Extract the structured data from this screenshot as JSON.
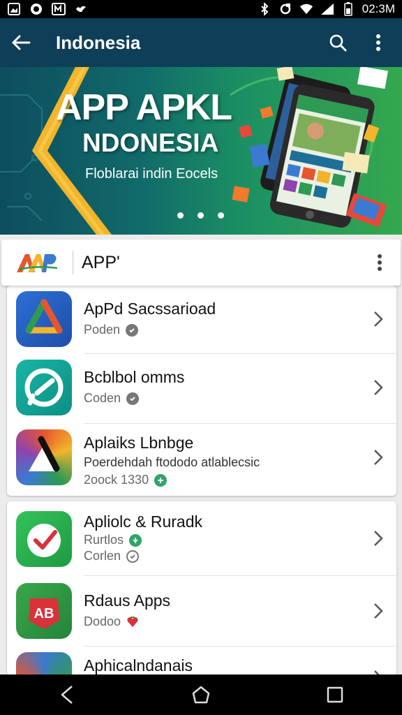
{
  "status_bar": {
    "time": "02:3M",
    "left_icons": [
      "gallery-icon",
      "record-icon",
      "m-app-icon",
      "bird-icon"
    ],
    "right_icons": [
      "bluetooth-icon",
      "sync-icon",
      "wifi-icon",
      "signal-icon",
      "battery-icon"
    ]
  },
  "app_bar": {
    "title": "Indonesia",
    "back_icon": "arrow-left-icon",
    "search_icon": "search-icon",
    "menu_icon": "more-vert-icon"
  },
  "banner": {
    "title": "APP APKL",
    "subtitle": "NDONESIA",
    "tagline": "Floblarai indin Eocels",
    "dots": 3
  },
  "section": {
    "title": "APP'",
    "logo_text": "AP",
    "menu_icon": "more-vert-icon"
  },
  "apps_group_1": [
    {
      "name": "ApPd Sacssarioad",
      "line2": "Poden",
      "badge": "check-circle-icon"
    },
    {
      "name": "Bcblbol omms",
      "line2": "Coden",
      "badge": "check-circle-icon"
    },
    {
      "name": "Aplaiks Lbnbge",
      "line2": "Poerdehdah ftododo atlablecsic",
      "line3": "2oock 1330",
      "badge": "verified-icon"
    }
  ],
  "apps_group_2": [
    {
      "name": "Apliolc & Ruradk",
      "line2": "Rurtlos",
      "line3": "Corlen",
      "badge": "verified-icon"
    },
    {
      "name": "Rdaus Apps",
      "line2": "Dodoo",
      "badge": "heart-icon"
    },
    {
      "name": "Aphicalndanais",
      "line2": "",
      "badge": ""
    }
  ],
  "colors": {
    "app_bar": "#0f3f58",
    "banner_start": "#0d4d5e",
    "banner_end": "#35a84f",
    "badge_gray": "#777777",
    "badge_green": "#2ea56a"
  },
  "nav_bar": {
    "back": "nav-back-icon",
    "home": "nav-home-icon",
    "recents": "nav-recents-icon"
  }
}
